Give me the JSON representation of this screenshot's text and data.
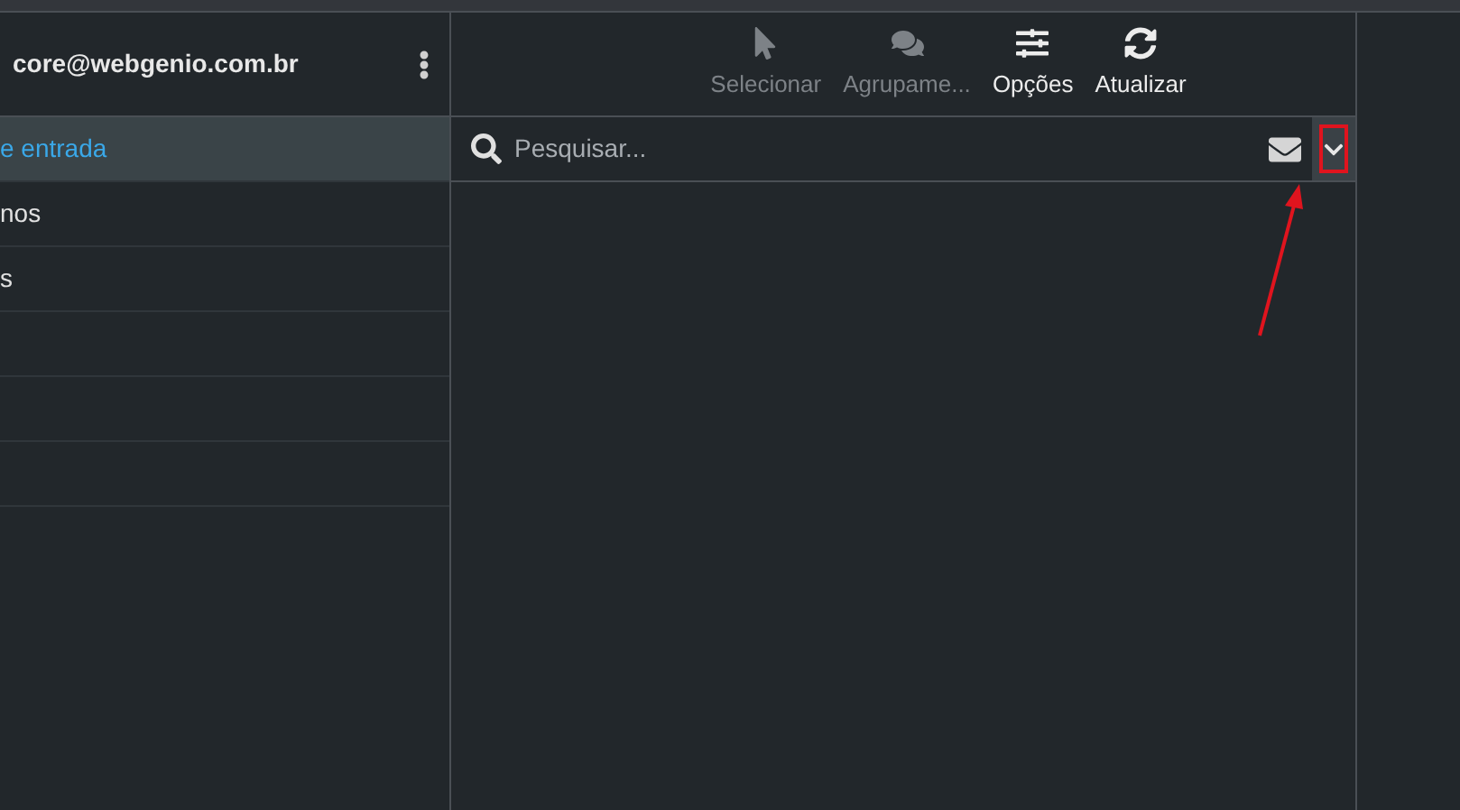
{
  "account": {
    "email": "core@webgenio.com.br"
  },
  "folders": [
    {
      "label": "e entrada",
      "selected": true
    },
    {
      "label": "nos",
      "selected": false
    },
    {
      "label": "s",
      "selected": false
    }
  ],
  "toolbar": [
    {
      "label": "Selecionar",
      "kind": "pointer",
      "disabled": true
    },
    {
      "label": "Agrupame...",
      "kind": "chat",
      "disabled": true
    },
    {
      "label": "Opções",
      "kind": "sliders",
      "disabled": false
    },
    {
      "label": "Atualizar",
      "kind": "refresh",
      "disabled": false
    }
  ],
  "search": {
    "placeholder": "Pesquisar..."
  },
  "dropdown": {
    "highlighted": true
  }
}
